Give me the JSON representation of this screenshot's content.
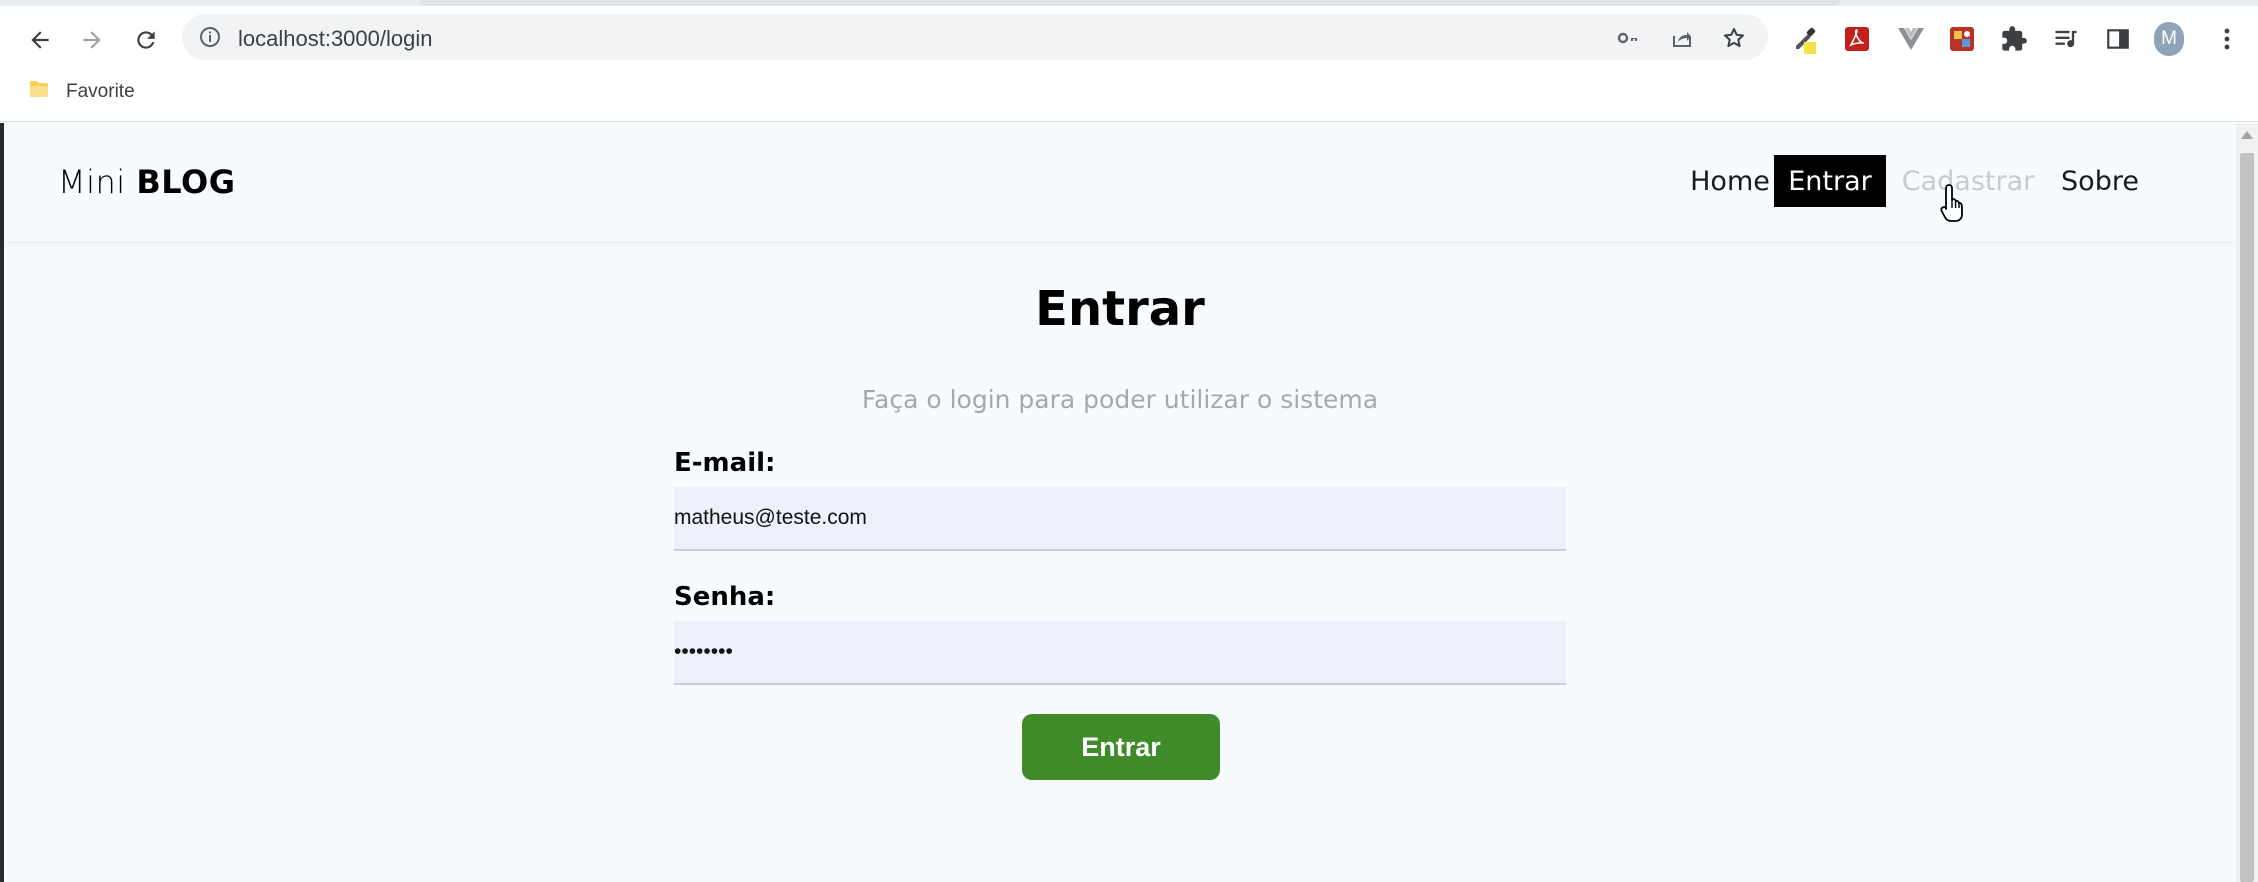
{
  "browser": {
    "url": "localhost:3000/login",
    "bookmark_label": "Favorite",
    "profile_initial": "M"
  },
  "site": {
    "brand_light": "Mini",
    "brand_bold": "BLOG",
    "nav": [
      {
        "label": "Home",
        "state": "normal"
      },
      {
        "label": "Entrar",
        "state": "active"
      },
      {
        "label": "Cadastrar",
        "state": "hover"
      },
      {
        "label": "Sobre",
        "state": "normal"
      }
    ]
  },
  "login": {
    "title": "Entrar",
    "subtitle": "Faça o login para poder utilizar o sistema",
    "email_label": "E-mail:",
    "email_value": "matheus@teste.com",
    "password_label": "Senha:",
    "password_value": "••••••••",
    "submit_label": "Entrar"
  },
  "colors": {
    "submit_button": "#3f8b2a",
    "active_nav_bg": "#000000",
    "input_bg": "#eef1fb",
    "page_bg": "#f8fbfe"
  },
  "icons": [
    "back-arrow-icon",
    "forward-arrow-icon",
    "reload-icon",
    "info-icon",
    "key-icon",
    "share-icon",
    "star-icon",
    "eyedropper-extension-icon",
    "pdf-extension-icon",
    "vue-extension-icon",
    "extension-puzzle-icon",
    "media-queue-icon",
    "side-panel-icon",
    "kebab-menu-icon",
    "folder-icon",
    "hand-cursor-icon"
  ]
}
